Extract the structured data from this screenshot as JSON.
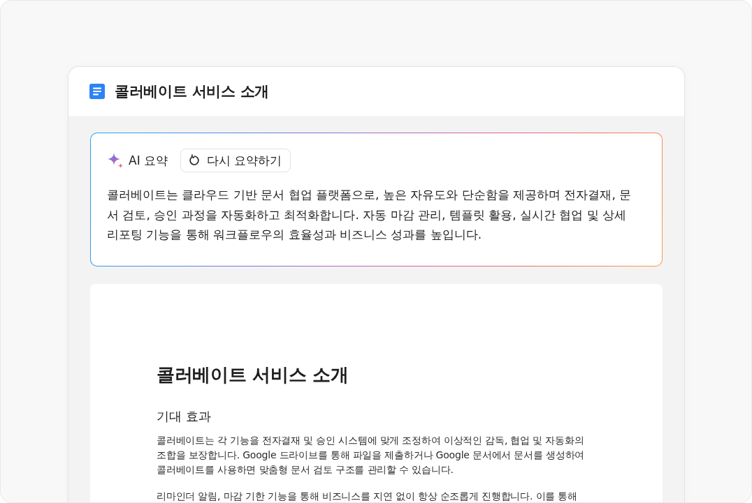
{
  "document_tab": {
    "title": "콜러베이트 서비스 소개"
  },
  "ai_summary": {
    "label": "AI 요약",
    "regenerate_button": "다시 요약하기",
    "text": "콜러베이트는 클라우드 기반 문서 협업 플랫폼으로, 높은 자유도와 단순함을 제공하며 전자결재, 문서 검토, 승인 과정을 자동화하고 최적화합니다. 자동 마감 관리, 템플릿 활용, 실시간 협업 및 상세 리포팅 기능을 통해 워크플로우의 효율성과 비즈니스 성과를 높입니다."
  },
  "document": {
    "title": "콜러베이트 서비스 소개",
    "sections": [
      {
        "heading": "기대 효과",
        "paragraphs": [
          "콜러베이트는 각 기능을 전자결재 및 승인 시스템에 맞게 조정하여 이상적인 감독, 협업 및 자동화의 조합을 보장합니다. Google 드라이브를 통해 파일을 제출하거나 Google 문서에서 문서를 생성하여 콜러베이트를 사용하면 맞춤형 문서 검토 구조를 관리할 수 있습니다.",
          "리마인더 알림, 마감 기한 기능을 통해 비즈니스를 지연 없이 항상 순조롭게 진행합니다. 이를 통해"
        ]
      }
    ]
  }
}
